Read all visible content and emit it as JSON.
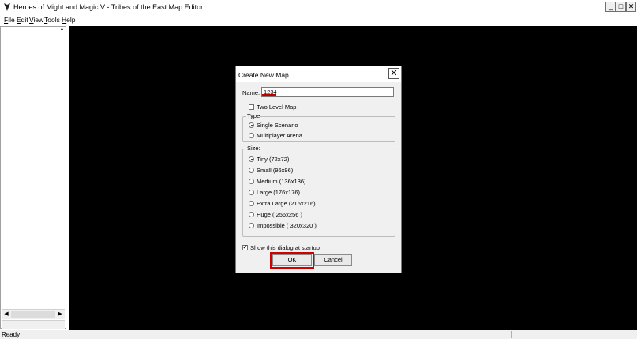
{
  "window": {
    "title": "Heroes of Might and Magic V - Tribes of the East Map Editor",
    "minimize": "_",
    "maximize": "□",
    "close": "✕"
  },
  "menu": [
    {
      "first": "F",
      "rest": "ile"
    },
    {
      "first": "E",
      "rest": "dit"
    },
    {
      "first": "V",
      "rest": "iew"
    },
    {
      "first": "T",
      "rest": "ools"
    },
    {
      "first": "H",
      "rest": "elp"
    }
  ],
  "sidebar": {
    "scroll_left": "◀",
    "scroll_right": "▶",
    "collapse": "▲"
  },
  "status": {
    "text": "Ready"
  },
  "dialog": {
    "title": "Create New Map",
    "close": "✕",
    "name_label": "Name:",
    "name_value": "1234",
    "two_level_label": "Two Level Map",
    "two_level_checked": false,
    "type_group": "Type",
    "type_options": [
      "Single Scenario",
      "Multiplayer Arena"
    ],
    "type_selected": "Single Scenario",
    "size_group": "Size:",
    "size_options": [
      "Tiny (72x72)",
      "Small  (96x96)",
      "Medium  (136x136)",
      "Large  (176x176)",
      "Extra Large  (216x216)",
      "Huge ( 256x256 )",
      "Impossible ( 320x320 )"
    ],
    "size_selected": "Tiny (72x72)",
    "show_startup_label": "Show this dialog at startup",
    "show_startup_checked": true,
    "ok_label": "OK",
    "cancel_label": "Cancel"
  },
  "colors": {
    "canvas": "#000000",
    "highlight": "#d00000"
  }
}
